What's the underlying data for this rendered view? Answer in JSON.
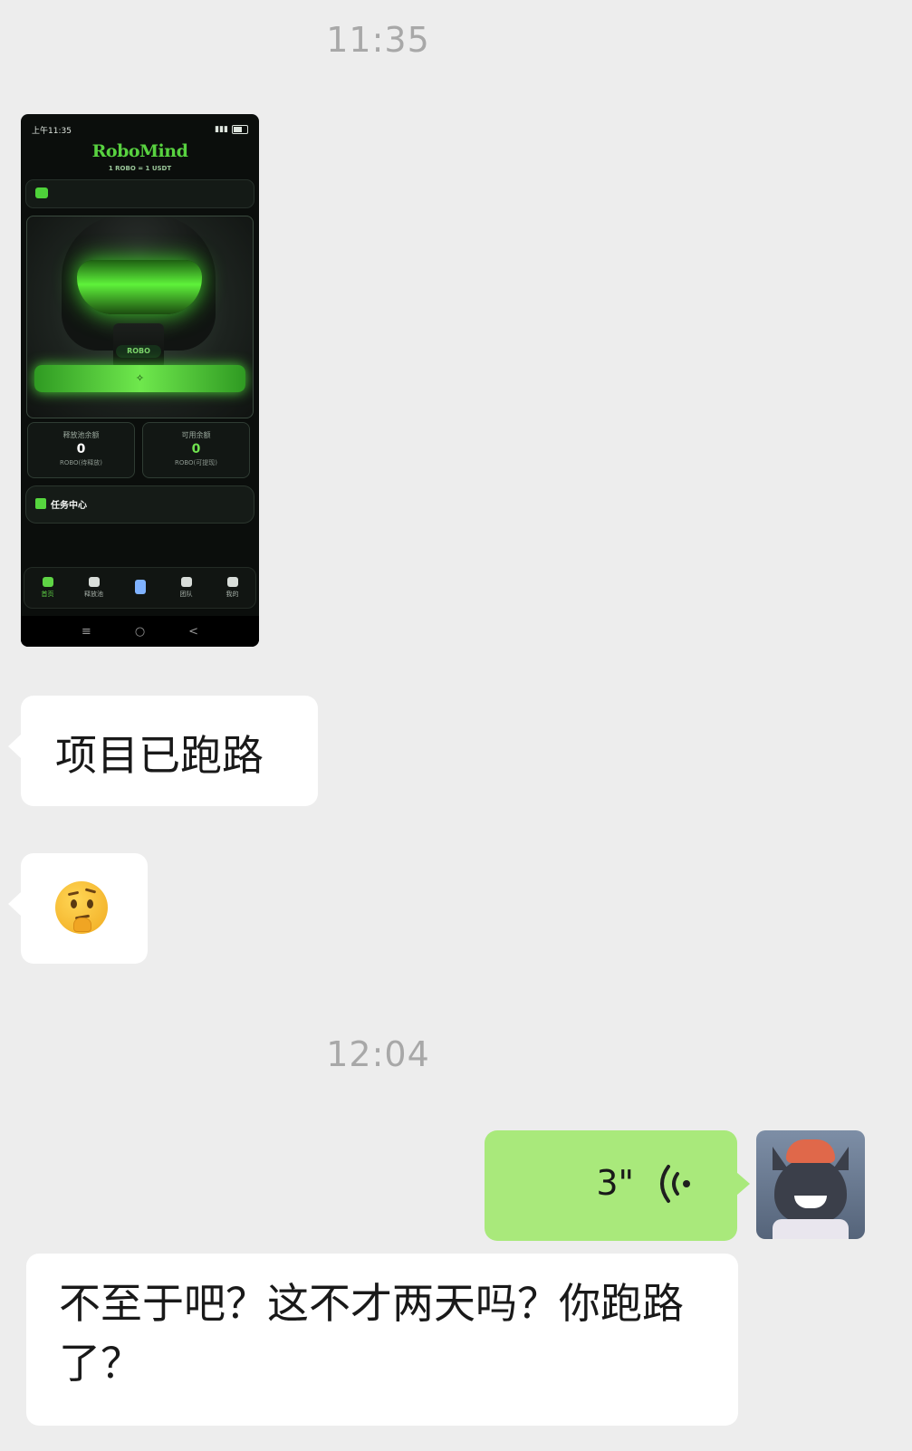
{
  "chat": {
    "timestamp_1": "11:35",
    "phone_screenshot": {
      "status_time": "上午11:35",
      "logo": "RoboMind",
      "rate": "1 ROBO = 1 USDT",
      "hero_tag": "ROBO",
      "card_left": {
        "label": "释放池余额",
        "value": "0",
        "sub": "ROBO(待释放)"
      },
      "card_right": {
        "label": "可用余额",
        "value": "0",
        "sub": "ROBO(可提现)"
      },
      "task_center": "任务中心",
      "nav": [
        "首页",
        "释放池",
        "",
        "团队",
        "我的"
      ],
      "sys_nav": [
        "≡",
        "○",
        "<"
      ]
    },
    "message_1": "项目已跑路",
    "message_2_emoji": "thinking-face",
    "timestamp_2": "12:04",
    "voice_duration": "3\"",
    "message_3": "不至于吧？这不才两天吗？你跑路了？"
  },
  "colors": {
    "background": "#ededed",
    "bubble_white": "#ffffff",
    "bubble_green": "#a9e97b",
    "timestamp": "#a8a8a8",
    "robomind_green": "#58d240"
  }
}
